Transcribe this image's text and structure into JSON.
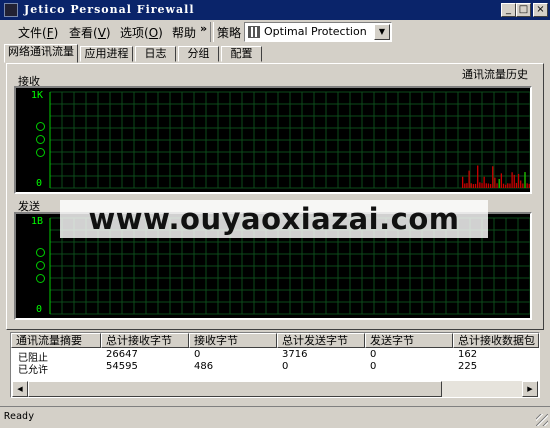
{
  "window": {
    "title": "Jetico Personal Firewall"
  },
  "menu": {
    "items": [
      {
        "label": "文件",
        "key": "F"
      },
      {
        "label": "查看",
        "key": "V"
      },
      {
        "label": "选项",
        "key": "O"
      },
      {
        "label": "帮助",
        "key": ""
      }
    ],
    "more": "»",
    "policy_label": "策略",
    "policy_value": "Optimal Protection"
  },
  "tabs": [
    "网络通讯流量",
    "应用进程",
    "日志",
    "分组",
    "配置"
  ],
  "traffic": {
    "history_label": "通讯流量历史",
    "receive": {
      "label": "接收",
      "ymax": "1K",
      "ymin": "0"
    },
    "send": {
      "label": "发送",
      "ymax": "1B",
      "ymin": "0"
    }
  },
  "chart_data": [
    {
      "type": "bar",
      "title": "接收",
      "ylabel": "",
      "ylim": [
        0,
        1024
      ],
      "ytick_labels": [
        "1K",
        "0"
      ],
      "grid": true,
      "series": [
        {
          "values": [
            120,
            48,
            52,
            185,
            50,
            42,
            44,
            240,
            60,
            52,
            120,
            50,
            48,
            42,
            232,
            110,
            50,
            96,
            156,
            46,
            34,
            50,
            48,
            168,
            140,
            54,
            150,
            80,
            48,
            168,
            50,
            44,
            150,
            60,
            46,
            176,
            48,
            54,
            156,
            54,
            48,
            156,
            44,
            50,
            160,
            52,
            46,
            50,
            168,
            44,
            54,
            128,
            46,
            50,
            42
          ],
          "color": "#cc0000"
        },
        {
          "values": [
            0,
            0,
            0,
            0,
            0,
            0,
            0,
            0,
            0,
            0,
            0,
            0,
            0,
            0,
            0,
            0,
            0,
            96,
            0,
            0,
            0,
            0,
            0,
            0,
            0,
            0,
            0,
            0,
            0,
            170,
            0,
            0,
            0,
            0,
            0,
            0,
            0,
            0,
            0,
            0,
            0,
            0,
            0,
            0,
            0,
            0,
            0,
            0,
            0,
            0,
            0,
            0,
            0,
            0,
            0
          ],
          "color": "#00cc00"
        }
      ]
    },
    {
      "type": "bar",
      "title": "发送",
      "ylim": [
        0,
        1
      ],
      "ytick_labels": [
        "1B",
        "0"
      ],
      "grid": true,
      "series": []
    }
  ],
  "summary": {
    "columns": [
      "通讯流量摘要",
      "总计接收字节",
      "接收字节",
      "总计发送字节",
      "发送字节",
      "总计接收数据包"
    ],
    "rows": [
      [
        "已阻止",
        "26647",
        "0",
        "3716",
        "0",
        "162"
      ],
      [
        "已允许",
        "54595",
        "486",
        "0",
        "0",
        "225"
      ]
    ]
  },
  "watermark": "www.ouyaoxiazai.com",
  "status": {
    "text": "Ready"
  }
}
